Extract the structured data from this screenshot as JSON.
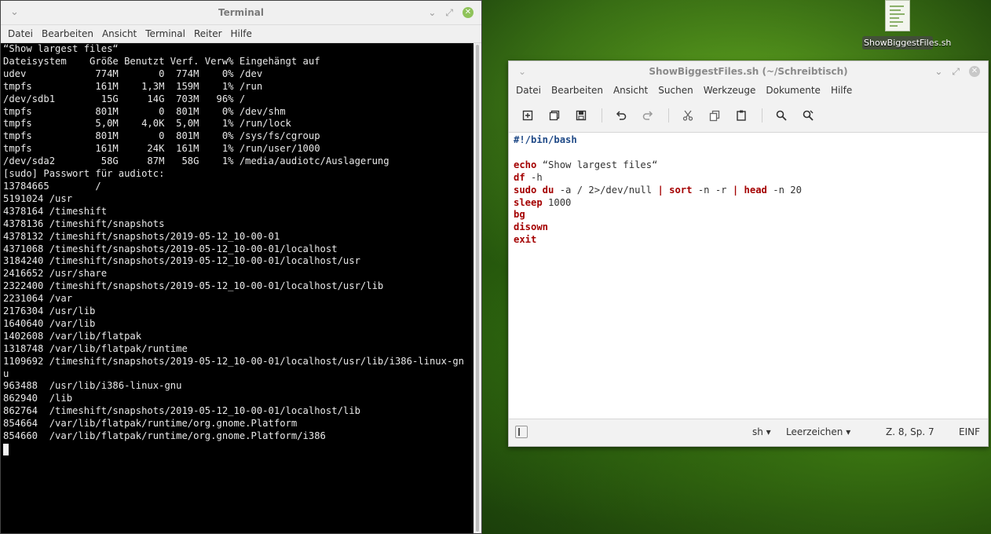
{
  "desktop": {
    "icon_label": "ShowBiggestFiles.sh"
  },
  "terminal": {
    "title": "Terminal",
    "menu": [
      "Datei",
      "Bearbeiten",
      "Ansicht",
      "Terminal",
      "Reiter",
      "Hilfe"
    ],
    "output": "“Show largest files“\nDateisystem    Größe Benutzt Verf. Verw% Eingehängt auf\nudev            774M       0  774M    0% /dev\ntmpfs           161M    1,3M  159M    1% /run\n/dev/sdb1        15G     14G  703M   96% /\ntmpfs           801M       0  801M    0% /dev/shm\ntmpfs           5,0M    4,0K  5,0M    1% /run/lock\ntmpfs           801M       0  801M    0% /sys/fs/cgroup\ntmpfs           161M     24K  161M    1% /run/user/1000\n/dev/sda2        58G     87M   58G    1% /media/audiotc/Auslagerung\n[sudo] Passwort für audiotc:\n13784665        /\n5191024 /usr\n4378164 /timeshift\n4378136 /timeshift/snapshots\n4378132 /timeshift/snapshots/2019-05-12_10-00-01\n4371068 /timeshift/snapshots/2019-05-12_10-00-01/localhost\n3184240 /timeshift/snapshots/2019-05-12_10-00-01/localhost/usr\n2416652 /usr/share\n2322400 /timeshift/snapshots/2019-05-12_10-00-01/localhost/usr/lib\n2231064 /var\n2176304 /usr/lib\n1640640 /var/lib\n1402608 /var/lib/flatpak\n1318748 /var/lib/flatpak/runtime\n1109692 /timeshift/snapshots/2019-05-12_10-00-01/localhost/usr/lib/i386-linux-gn\nu\n963488  /usr/lib/i386-linux-gnu\n862940  /lib\n862764  /timeshift/snapshots/2019-05-12_10-00-01/localhost/lib\n854664  /var/lib/flatpak/runtime/org.gnome.Platform\n854660  /var/lib/flatpak/runtime/org.gnome.Platform/i386\n"
  },
  "editor": {
    "title": "ShowBiggestFiles.sh (~/Schreibtisch)",
    "menu": [
      "Datei",
      "Bearbeiten",
      "Ansicht",
      "Suchen",
      "Werkzeuge",
      "Dokumente",
      "Hilfe"
    ],
    "code": {
      "l1": "#!/bin/bash",
      "l3_kw": "echo",
      "l3_rest": " “Show largest files“",
      "l4_kw": "df",
      "l4_rest": " -h",
      "l5_a": "sudo du",
      "l5_b": " -a / 2>/dev/null ",
      "l5_c": "| sort",
      "l5_d": " -n -r ",
      "l5_e": "| head",
      "l5_f": " -n 20",
      "l6_kw": "sleep",
      "l6_rest": " 1000",
      "l7": "bg",
      "l8": "disown",
      "l9": "exit"
    },
    "status": {
      "language": "sh",
      "indent": "Leerzeichen",
      "position": "Z. 8, Sp. 7",
      "mode": "EINF"
    }
  },
  "colors": {
    "keyword": "#a40000",
    "shebang": "#204a87",
    "close_button": "#8fc35a"
  }
}
